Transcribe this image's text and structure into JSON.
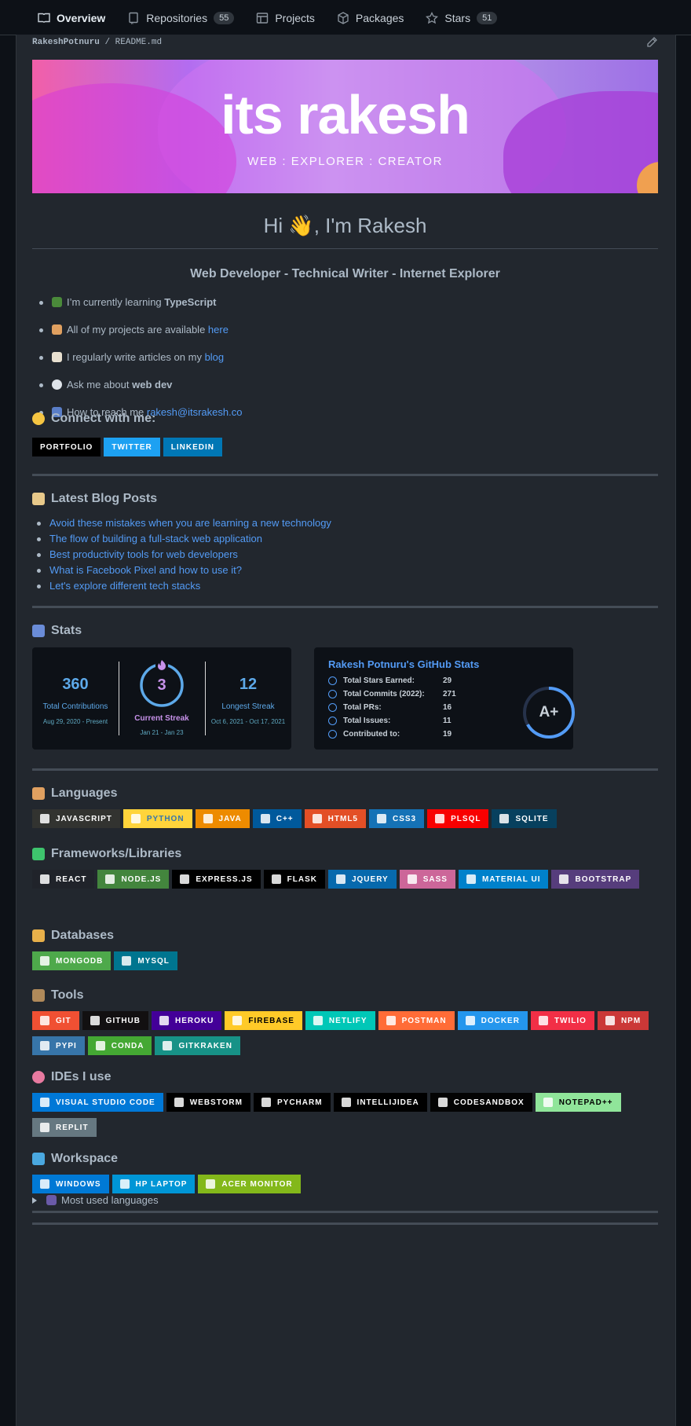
{
  "nav": {
    "tabs": [
      {
        "label": "Overview",
        "count": ""
      },
      {
        "label": "Repositories",
        "count": "55"
      },
      {
        "label": "Projects",
        "count": ""
      },
      {
        "label": "Packages",
        "count": ""
      },
      {
        "label": "Stars",
        "count": "51"
      }
    ]
  },
  "file": {
    "owner": "RakeshPotnuru",
    "path": "README.md",
    "sep": "/"
  },
  "banner": {
    "title": "its rakesh",
    "subtitle": "WEB : EXPLORER : CREATOR"
  },
  "greeting": "Hi 👋, I'm Rakesh",
  "tagline": "Web Developer - Technical Writer - Internet Explorer",
  "bullets": [
    {
      "text": "I’m currently learning ",
      "bold": "TypeScript",
      "link": ""
    },
    {
      "text": "All of my projects are available ",
      "bold": "",
      "link": "here"
    },
    {
      "text": "I regularly write articles on my ",
      "bold": "",
      "link": "blog"
    },
    {
      "text": "Ask me about ",
      "bold": "web dev",
      "link": ""
    },
    {
      "text": "How to reach me ",
      "bold": "",
      "link": "rakesh@itsrakesh.co"
    }
  ],
  "connect": {
    "heading": "Connect with me:",
    "badges": [
      {
        "label": "PORTFOLIO",
        "color": "#000000"
      },
      {
        "label": "TWITTER",
        "color": "#1DA1F2"
      },
      {
        "label": "LINKEDIN",
        "color": "#0077B5"
      }
    ]
  },
  "blog": {
    "heading": "Latest Blog Posts",
    "posts": [
      "Avoid these mistakes when you are learning a new technology",
      "The flow of building a full-stack web application",
      "Best productivity tools for web developers",
      "What is Facebook Pixel and how to use it?",
      "Let's explore different tech stacks"
    ]
  },
  "stats": {
    "heading": "Stats",
    "streak": {
      "total": "360",
      "total_label": "Total Contributions",
      "total_range": "Aug 29, 2020 - Present",
      "current": "3",
      "current_label": "Current Streak",
      "current_range": "Jan 21 - Jan 23",
      "longest": "12",
      "longest_label": "Longest Streak",
      "longest_range": "Oct 6, 2021 - Oct 17, 2021",
      "colors": {
        "number": "#5DA9E9",
        "label": "#5DA9E9",
        "current": "#C792EA",
        "range": "#4FB0A8"
      }
    },
    "github": {
      "title": "Rakesh Potnuru's GitHub Stats",
      "rank": "A+",
      "rows": [
        {
          "label": "Total Stars Earned:",
          "value": "29",
          "icon": "star-icon"
        },
        {
          "label": "Total Commits (2022):",
          "value": "271",
          "icon": "history-icon"
        },
        {
          "label": "Total PRs:",
          "value": "16",
          "icon": "pull-request-icon"
        },
        {
          "label": "Total Issues:",
          "value": "11",
          "icon": "issue-icon"
        },
        {
          "label": "Contributed to:",
          "value": "19",
          "icon": "repo-icon"
        }
      ]
    }
  },
  "languages": {
    "heading": "Languages",
    "badges": [
      {
        "label": "JAVASCRIPT",
        "color": "#323330"
      },
      {
        "label": "PYTHON",
        "color": "#FFD43B",
        "text": "#3776AB"
      },
      {
        "label": "JAVA",
        "color": "#ED8B00"
      },
      {
        "label": "C++",
        "color": "#00599C"
      },
      {
        "label": "HTML5",
        "color": "#E34F26"
      },
      {
        "label": "CSS3",
        "color": "#1572B6"
      },
      {
        "label": "PLSQL",
        "color": "#F80000"
      },
      {
        "label": "SQLITE",
        "color": "#07405E"
      }
    ]
  },
  "frameworks": {
    "heading": "Frameworks/Libraries",
    "badges": [
      {
        "label": "REACT",
        "color": "#20232A"
      },
      {
        "label": "NODE.JS",
        "color": "#43853D"
      },
      {
        "label": "EXPRESS.JS",
        "color": "#000000"
      },
      {
        "label": "FLASK",
        "color": "#000000"
      },
      {
        "label": "JQUERY",
        "color": "#0769AD"
      },
      {
        "label": "SASS",
        "color": "#CC6699"
      },
      {
        "label": "MATERIAL UI",
        "color": "#0081CB"
      },
      {
        "label": "BOOTSTRAP",
        "color": "#563D7C"
      }
    ]
  },
  "databases": {
    "heading": "Databases",
    "badges": [
      {
        "label": "MONGODB",
        "color": "#4EA94B"
      },
      {
        "label": "MYSQL",
        "color": "#00758F"
      }
    ]
  },
  "tools": {
    "heading": "Tools",
    "badges": [
      {
        "label": "GIT",
        "color": "#F05033"
      },
      {
        "label": "GITHUB",
        "color": "#121011"
      },
      {
        "label": "HEROKU",
        "color": "#430098"
      },
      {
        "label": "FIREBASE",
        "color": "#FFCA28",
        "text": "#000000"
      },
      {
        "label": "NETLIFY",
        "color": "#00C7B7"
      },
      {
        "label": "POSTMAN",
        "color": "#FF6C37"
      },
      {
        "label": "DOCKER",
        "color": "#2496ED"
      },
      {
        "label": "TWILIO",
        "color": "#F22F46"
      },
      {
        "label": "NPM",
        "color": "#CB3837"
      },
      {
        "label": "PYPI",
        "color": "#3775A9"
      },
      {
        "label": "CONDA",
        "color": "#44A833"
      },
      {
        "label": "GITKRAKEN",
        "color": "#179287"
      }
    ]
  },
  "ides": {
    "heading": "IDEs I use",
    "badges": [
      {
        "label": "VISUAL STUDIO CODE",
        "color": "#0078D7"
      },
      {
        "label": "WEBSTORM",
        "color": "#000000"
      },
      {
        "label": "PYCHARM",
        "color": "#000000"
      },
      {
        "label": "INTELLIJIDEA",
        "color": "#000000"
      },
      {
        "label": "CODESANDBOX",
        "color": "#040404"
      },
      {
        "label": "NOTEPAD++",
        "color": "#90E59A",
        "text": "#000000"
      },
      {
        "label": "REPLIT",
        "color": "#667881"
      }
    ]
  },
  "workspace": {
    "heading": "Workspace",
    "badges": [
      {
        "label": "WINDOWS",
        "color": "#0079D5"
      },
      {
        "label": "HP LAPTOP",
        "color": "#0096D6"
      },
      {
        "label": "ACER MONITOR",
        "color": "#83B81A"
      }
    ]
  },
  "details": {
    "summary": "Most used languages"
  }
}
